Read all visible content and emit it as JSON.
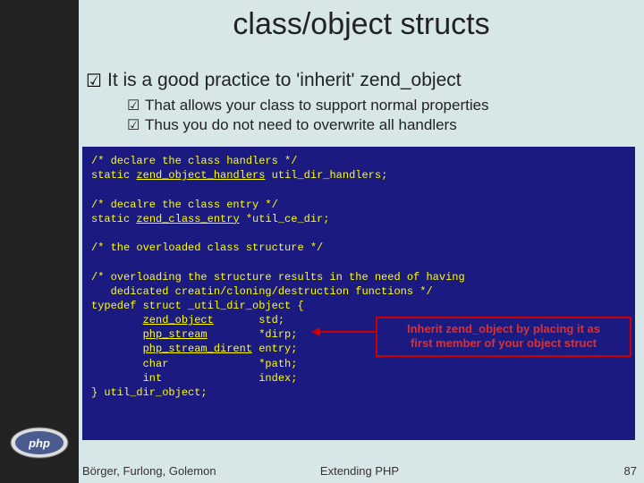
{
  "title": "class/object structs",
  "main_point": "It is a good practice to 'inherit' zend_object",
  "sub_points": [
    "That allows your class to support normal properties",
    "Thus you do not need to overwrite all handlers"
  ],
  "code": {
    "l1": "/* declare the class handlers */",
    "l2a": "static ",
    "l2b": "zend_object_handlers",
    "l2c": " util_dir_handlers;",
    "l3": "/* decalre the class entry */",
    "l4a": "static ",
    "l4b": "zend_class_entry",
    "l4c": " *util_ce_dir;",
    "l5": "/* the overloaded class structure */",
    "l6": "/* overloading the structure results in the need of having",
    "l7": "   dedicated creatin/cloning/destruction functions */",
    "l8": "typedef struct _util_dir_object {",
    "l9a": "        ",
    "l9b": "zend_object",
    "l9c": "       std;",
    "l10a": "        ",
    "l10b": "php_stream",
    "l10c": "        *dirp;",
    "l11a": "        ",
    "l11b": "php_stream_dirent",
    "l11c": " entry;",
    "l12": "        char              *path;",
    "l13": "        int               index;",
    "l14": "} util_dir_object;"
  },
  "callout": {
    "line1": "Inherit zend_object by placing it as",
    "line2": "first member of your object struct"
  },
  "footer": {
    "authors": "Börger, Furlong, Golemon",
    "center": "Extending PHP",
    "page": "87"
  },
  "check": "☑"
}
